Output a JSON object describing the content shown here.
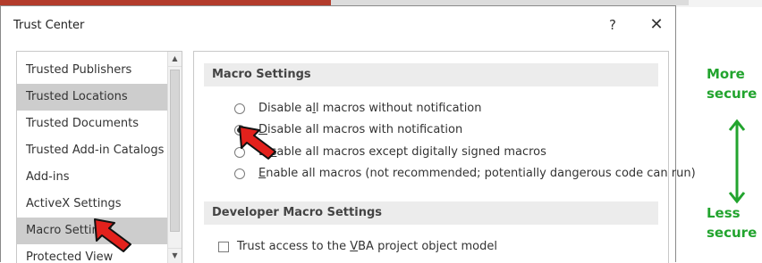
{
  "dialog": {
    "title": "Trust Center",
    "help_label": "?",
    "close_label": "✕"
  },
  "sidebar": {
    "items": [
      {
        "label": "Trusted Publishers",
        "selected": false
      },
      {
        "label": "Trusted Locations",
        "selected": true
      },
      {
        "label": "Trusted Documents",
        "selected": false
      },
      {
        "label": "Trusted Add-in Catalogs",
        "selected": false
      },
      {
        "label": "Add-ins",
        "selected": false
      },
      {
        "label": "ActiveX Settings",
        "selected": false
      },
      {
        "label": "Macro Settings",
        "selected": true
      },
      {
        "label": "Protected View",
        "selected": false
      }
    ],
    "scroll_up_glyph": "▲",
    "scroll_down_glyph": "▼"
  },
  "macro_settings": {
    "header": "Macro Settings",
    "options": [
      {
        "pre": "Disable a",
        "u": "l",
        "post": "l macros without notification",
        "checked": false
      },
      {
        "pre": "",
        "u": "D",
        "post": "isable all macros with notification",
        "checked": true
      },
      {
        "pre": "Di",
        "u": "s",
        "post": "able all macros except digitally signed macros",
        "checked": false
      },
      {
        "pre": "",
        "u": "E",
        "post": "nable all macros (not recommended; potentially dangerous code can run)",
        "checked": false
      }
    ]
  },
  "developer_settings": {
    "header": "Developer Macro Settings",
    "trust_vba": {
      "pre": "Trust access to the ",
      "u": "V",
      "post": "BA project object model",
      "checked": false
    }
  },
  "security_scale": {
    "more_line1": "More",
    "more_line2": "secure",
    "less_line1": "Less",
    "less_line2": "secure",
    "color": "#22a42e"
  },
  "annotation_color": "#e3211c"
}
